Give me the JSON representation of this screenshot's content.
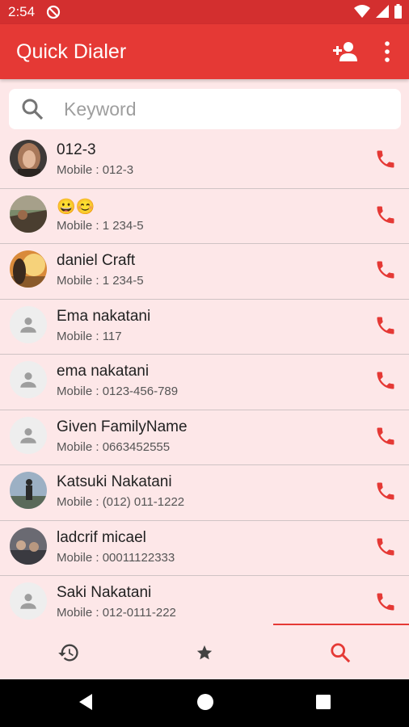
{
  "status_bar": {
    "time": "2:54"
  },
  "app_bar": {
    "title": "Quick Dialer",
    "add_icon": "person-add-icon",
    "more_icon": "more-vert-icon"
  },
  "search": {
    "placeholder": "Keyword",
    "value": ""
  },
  "contacts": [
    {
      "name": "012-3",
      "detail": "Mobile : 012-3",
      "avatar": "photo-portrait"
    },
    {
      "name": "😀😊",
      "detail": "Mobile : 1 234-5",
      "avatar": "photo-landscape"
    },
    {
      "name": "daniel Craft",
      "detail": "Mobile : 1 234-5",
      "avatar": "photo-sunset"
    },
    {
      "name": "Ema nakatani",
      "detail": "Mobile : 117",
      "avatar": "default-person"
    },
    {
      "name": "ema nakatani",
      "detail": "Mobile : 0123-456-789",
      "avatar": "default-person"
    },
    {
      "name": "Given FamilyName",
      "detail": "Mobile : 0663452555",
      "avatar": "default-person"
    },
    {
      "name": "Katsuki Nakatani",
      "detail": "Mobile : (012) 011-1222",
      "avatar": "photo-figure"
    },
    {
      "name": "ladcrif micael",
      "detail": "Mobile : 00011122333",
      "avatar": "photo-group"
    },
    {
      "name": "Saki Nakatani",
      "detail": "Mobile : 012-0111-222",
      "avatar": "default-person"
    }
  ],
  "bottom_nav": {
    "items": [
      {
        "icon": "history-icon",
        "active": false
      },
      {
        "icon": "star-icon",
        "active": false
      },
      {
        "icon": "search-icon",
        "active": true
      }
    ]
  },
  "colors": {
    "primary": "#e53935",
    "status_bar": "#d32f2f",
    "background": "#fde7e8",
    "call": "#e53935"
  }
}
